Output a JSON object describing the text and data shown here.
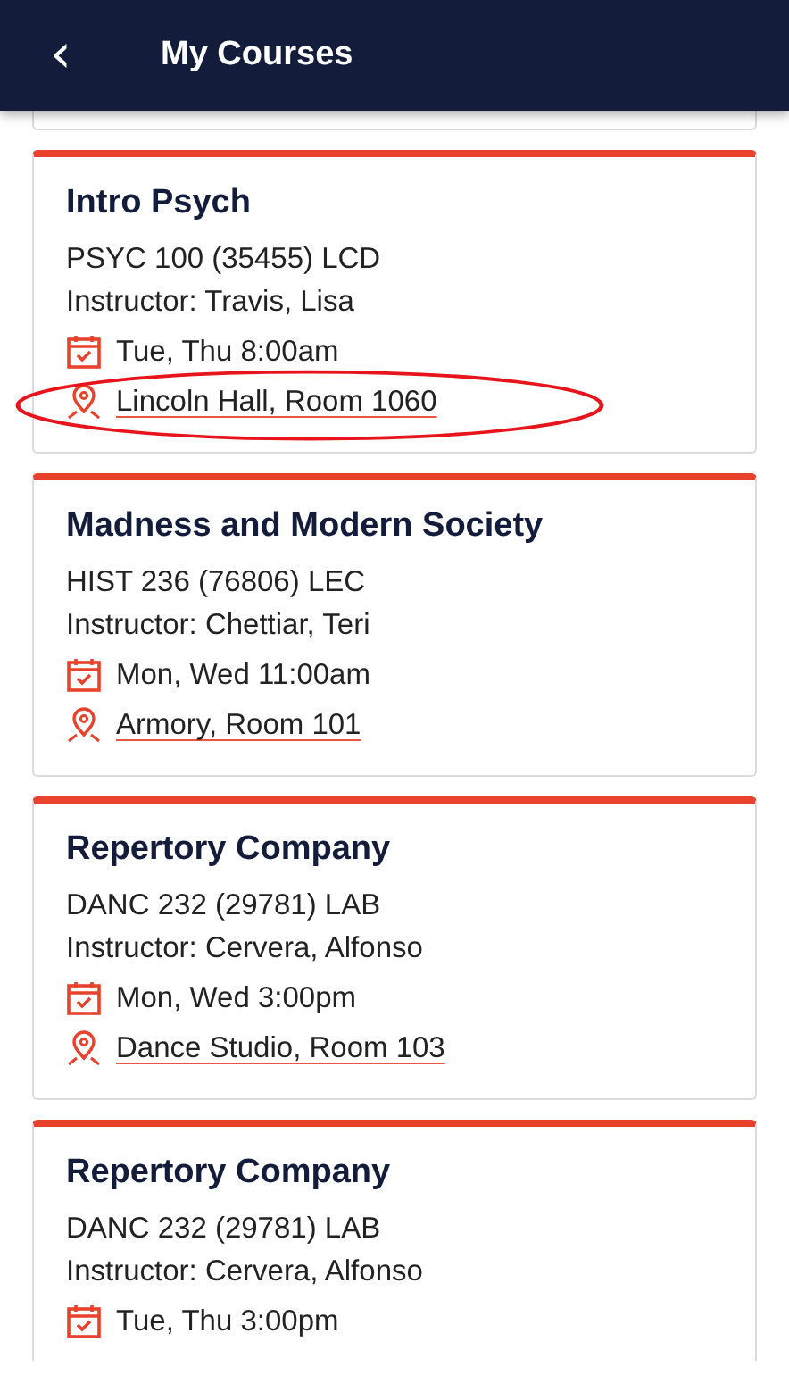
{
  "header": {
    "back_icon": "‹",
    "title": "My Courses"
  },
  "courses": [
    {
      "title": "Intro Psych",
      "code": "PSYC 100 (35455) LCD",
      "instructor": "Instructor: Travis, Lisa",
      "schedule": "Tue, Thu 8:00am",
      "location": "Lincoln Hall, Room 1060",
      "highlighted": true
    },
    {
      "title": "Madness and Modern Society",
      "code": "HIST 236 (76806) LEC",
      "instructor": "Instructor: Chettiar, Teri",
      "schedule": "Mon, Wed 11:00am",
      "location": "Armory, Room 101",
      "highlighted": false
    },
    {
      "title": "Repertory Company",
      "code": "DANC 232 (29781) LAB",
      "instructor": "Instructor: Cervera, Alfonso",
      "schedule": "Mon, Wed 3:00pm",
      "location": "Dance Studio, Room 103",
      "highlighted": false
    },
    {
      "title": "Repertory Company",
      "code": "DANC 232 (29781) LAB",
      "instructor": "Instructor: Cervera, Alfonso",
      "schedule": "Tue, Thu 3:00pm",
      "highlighted": false
    }
  ]
}
